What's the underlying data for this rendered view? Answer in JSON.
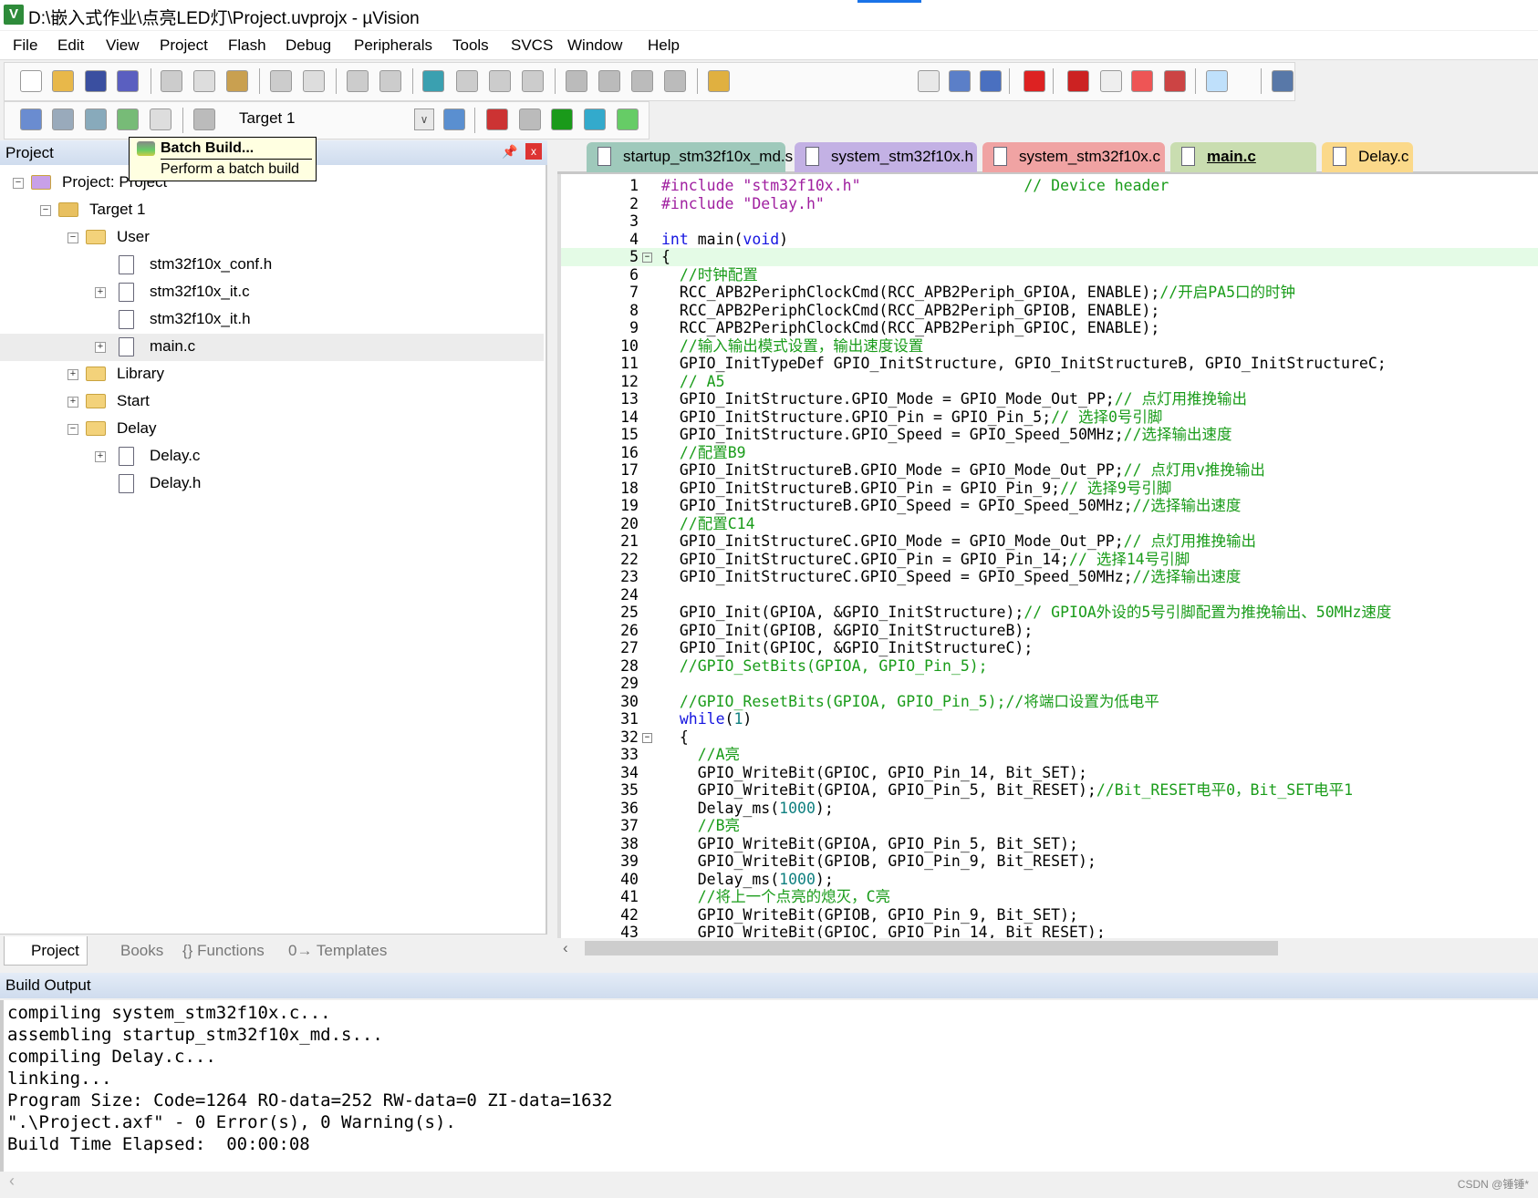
{
  "window": {
    "title": "D:\\嵌入式作业\\点亮LED灯\\Project.uvprojx - µVision",
    "icon": "V"
  },
  "menu": [
    "File",
    "Edit",
    "View",
    "Project",
    "Flash",
    "Debug",
    "Peripherals",
    "Tools",
    "SVCS",
    "Window",
    "Help"
  ],
  "toolbar": {
    "target": "Target 1"
  },
  "tooltip": {
    "title": "Batch Build...",
    "description": "Perform a batch build"
  },
  "project_panel": {
    "title": "Project",
    "tree": [
      {
        "label": "Project: Project",
        "level": 0,
        "type": "project",
        "expander": "minus"
      },
      {
        "label": "Target 1",
        "level": 1,
        "type": "target",
        "expander": "minus"
      },
      {
        "label": "User",
        "level": 2,
        "type": "folder",
        "expander": "minus"
      },
      {
        "label": "stm32f10x_conf.h",
        "level": 3,
        "type": "file",
        "expander": ""
      },
      {
        "label": "stm32f10x_it.c",
        "level": 3,
        "type": "file",
        "expander": "plus"
      },
      {
        "label": "stm32f10x_it.h",
        "level": 3,
        "type": "file",
        "expander": ""
      },
      {
        "label": "main.c",
        "level": 3,
        "type": "file",
        "expander": "plus",
        "selected": true
      },
      {
        "label": "Library",
        "level": 2,
        "type": "folder",
        "expander": "plus"
      },
      {
        "label": "Start",
        "level": 2,
        "type": "folder",
        "expander": "plus"
      },
      {
        "label": "Delay",
        "level": 2,
        "type": "folder",
        "expander": "minus"
      },
      {
        "label": "Delay.c",
        "level": 3,
        "type": "file",
        "expander": "plus"
      },
      {
        "label": "Delay.h",
        "level": 3,
        "type": "file",
        "expander": ""
      }
    ],
    "tabs": [
      "Project",
      "Books",
      "{} Functions",
      "0→ Templates"
    ]
  },
  "editor": {
    "tabs": [
      {
        "label": "startup_stm32f10x_md.s",
        "color": "#9fc9bb"
      },
      {
        "label": "system_stm32f10x.h",
        "color": "#c3b1e4"
      },
      {
        "label": "system_stm32f10x.c",
        "color": "#f0a3a3"
      },
      {
        "label": "main.c",
        "color": "#c9ddb0",
        "active": true
      },
      {
        "label": "Delay.c",
        "color": "#fbd98a"
      }
    ],
    "current_line": 5,
    "lines": [
      [
        [
          "p",
          ""
        ],
        [
          "s",
          "#include \"stm32f10x.h\""
        ],
        [
          "p",
          "                  "
        ],
        [
          "c",
          "// Device header"
        ]
      ],
      [
        [
          "s",
          "#include \"Delay.h\""
        ]
      ],
      [],
      [
        [
          "k",
          "int"
        ],
        [
          "p",
          " main("
        ],
        [
          "k",
          "void"
        ],
        [
          "p",
          ")"
        ]
      ],
      [
        [
          "p",
          "{"
        ]
      ],
      [
        [
          "c",
          "  //时钟配置"
        ]
      ],
      [
        [
          "p",
          "  RCC_APB2PeriphClockCmd(RCC_APB2Periph_GPIOA, ENABLE);"
        ],
        [
          "c",
          "//开启PA5口的时钟"
        ]
      ],
      [
        [
          "p",
          "  RCC_APB2PeriphClockCmd(RCC_APB2Periph_GPIOB, ENABLE);"
        ]
      ],
      [
        [
          "p",
          "  RCC_APB2PeriphClockCmd(RCC_APB2Periph_GPIOC, ENABLE);"
        ]
      ],
      [
        [
          "c",
          "  //输入输出模式设置，输出速度设置"
        ]
      ],
      [
        [
          "p",
          "  GPIO_InitTypeDef GPIO_InitStructure, GPIO_InitStructureB, GPIO_InitStructureC;"
        ]
      ],
      [
        [
          "c",
          "  // A5"
        ]
      ],
      [
        [
          "p",
          "  GPIO_InitStructure.GPIO_Mode = GPIO_Mode_Out_PP;"
        ],
        [
          "c",
          "// 点灯用推挽输出"
        ]
      ],
      [
        [
          "p",
          "  GPIO_InitStructure.GPIO_Pin = GPIO_Pin_5;"
        ],
        [
          "c",
          "// 选择0号引脚"
        ]
      ],
      [
        [
          "p",
          "  GPIO_InitStructure.GPIO_Speed = GPIO_Speed_50MHz;"
        ],
        [
          "c",
          "//选择输出速度"
        ]
      ],
      [
        [
          "c",
          "  //配置B9"
        ]
      ],
      [
        [
          "p",
          "  GPIO_InitStructureB.GPIO_Mode = GPIO_Mode_Out_PP;"
        ],
        [
          "c",
          "// 点灯用v推挽输出"
        ]
      ],
      [
        [
          "p",
          "  GPIO_InitStructureB.GPIO_Pin = GPIO_Pin_9;"
        ],
        [
          "c",
          "// 选择9号引脚"
        ]
      ],
      [
        [
          "p",
          "  GPIO_InitStructureB.GPIO_Speed = GPIO_Speed_50MHz;"
        ],
        [
          "c",
          "//选择输出速度"
        ]
      ],
      [
        [
          "c",
          "  //配置C14"
        ]
      ],
      [
        [
          "p",
          "  GPIO_InitStructureC.GPIO_Mode = GPIO_Mode_Out_PP;"
        ],
        [
          "c",
          "// 点灯用推挽输出"
        ]
      ],
      [
        [
          "p",
          "  GPIO_InitStructureC.GPIO_Pin = GPIO_Pin_14;"
        ],
        [
          "c",
          "// 选择14号引脚"
        ]
      ],
      [
        [
          "p",
          "  GPIO_InitStructureC.GPIO_Speed = GPIO_Speed_50MHz;"
        ],
        [
          "c",
          "//选择输出速度"
        ]
      ],
      [],
      [
        [
          "p",
          "  GPIO_Init(GPIOA, &GPIO_InitStructure);"
        ],
        [
          "c",
          "// GPIOA外设的5号引脚配置为推挽输出、50MHz速度"
        ]
      ],
      [
        [
          "p",
          "  GPIO_Init(GPIOB, &GPIO_InitStructureB);"
        ]
      ],
      [
        [
          "p",
          "  GPIO_Init(GPIOC, &GPIO_InitStructureC);"
        ]
      ],
      [
        [
          "c",
          "  //GPIO_SetBits(GPIOA, GPIO_Pin_5);"
        ]
      ],
      [],
      [
        [
          "c",
          "  //GPIO_ResetBits(GPIOA, GPIO_Pin_5);//将端口设置为低电平"
        ]
      ],
      [
        [
          "k",
          "  while"
        ],
        [
          "p",
          "("
        ],
        [
          "n",
          "1"
        ],
        [
          "p",
          ")"
        ]
      ],
      [
        [
          "p",
          "  {"
        ]
      ],
      [
        [
          "c",
          "    //A亮"
        ]
      ],
      [
        [
          "p",
          "    GPIO_WriteBit(GPIOC, GPIO_Pin_14, Bit_SET);"
        ]
      ],
      [
        [
          "p",
          "    GPIO_WriteBit(GPIOA, GPIO_Pin_5, Bit_RESET);"
        ],
        [
          "c",
          "//Bit_RESET电平0，Bit_SET电平1"
        ]
      ],
      [
        [
          "p",
          "    Delay_ms("
        ],
        [
          "n",
          "1000"
        ],
        [
          "p",
          ");"
        ]
      ],
      [
        [
          "c",
          "    //B亮"
        ]
      ],
      [
        [
          "p",
          "    GPIO_WriteBit(GPIOA, GPIO_Pin_5, Bit_SET);"
        ]
      ],
      [
        [
          "p",
          "    GPIO_WriteBit(GPIOB, GPIO_Pin_9, Bit_RESET);"
        ]
      ],
      [
        [
          "p",
          "    Delay_ms("
        ],
        [
          "n",
          "1000"
        ],
        [
          "p",
          ");"
        ]
      ],
      [
        [
          "c",
          "    //将上一个点亮的熄灭，C亮"
        ]
      ],
      [
        [
          "p",
          "    GPIO_WriteBit(GPIOB, GPIO_Pin_9, Bit_SET);"
        ]
      ],
      [
        [
          "p",
          "    GPIO_WriteBit(GPIOC, GPIO_Pin_14, Bit_RESET);"
        ]
      ]
    ],
    "fold_lines": [
      5,
      32
    ]
  },
  "build_output": {
    "title": "Build Output",
    "lines": [
      "compiling system_stm32f10x.c...",
      "assembling startup_stm32f10x_md.s...",
      "compiling Delay.c...",
      "linking...",
      "Program Size: Code=1264 RO-data=252 RW-data=0 ZI-data=1632",
      "\".\\Project.axf\" - 0 Error(s), 0 Warning(s).",
      "Build Time Elapsed:  00:00:08"
    ]
  },
  "watermark": "CSDN @锤锤*"
}
